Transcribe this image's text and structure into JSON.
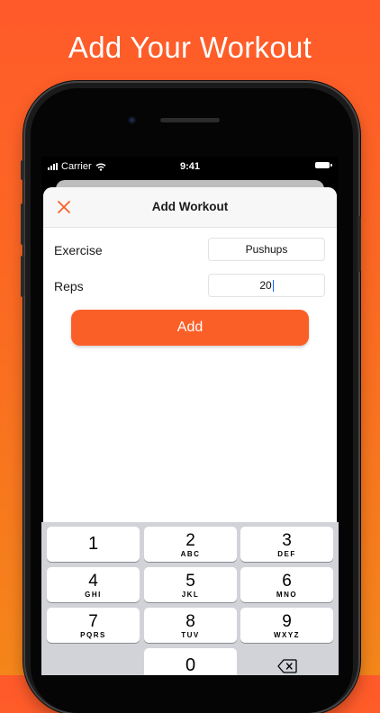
{
  "headline": "Add Your Workout",
  "status_bar": {
    "carrier": "Carrier",
    "time": "9:41"
  },
  "nav": {
    "title": "Add Workout",
    "close_icon": "close-icon"
  },
  "form": {
    "exercise_label": "Exercise",
    "exercise_value": "Pushups",
    "reps_label": "Reps",
    "reps_value": "20",
    "add_label": "Add"
  },
  "keypad": {
    "keys": [
      {
        "num": "1",
        "letters": ""
      },
      {
        "num": "2",
        "letters": "ABC"
      },
      {
        "num": "3",
        "letters": "DEF"
      },
      {
        "num": "4",
        "letters": "GHI"
      },
      {
        "num": "5",
        "letters": "JKL"
      },
      {
        "num": "6",
        "letters": "MNO"
      },
      {
        "num": "7",
        "letters": "PQRS"
      },
      {
        "num": "8",
        "letters": "TUV"
      },
      {
        "num": "9",
        "letters": "WXYZ"
      },
      {
        "num": "0",
        "letters": ""
      }
    ],
    "delete_icon": "backspace-icon"
  },
  "colors": {
    "accent": "#fb5f28",
    "background_top": "#ff5a2a",
    "background_bottom": "#f4861a"
  }
}
